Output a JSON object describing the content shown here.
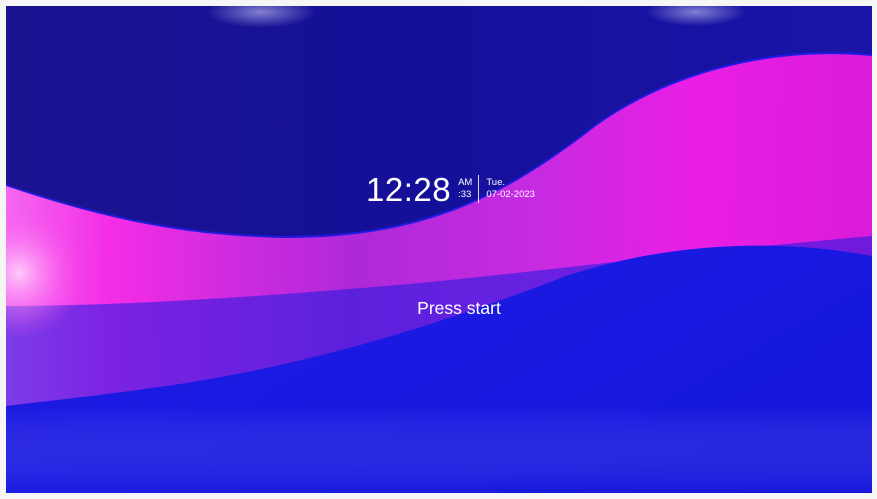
{
  "screen": {
    "time": "12:28",
    "ampm": "AM",
    "seconds": ":33",
    "weekday": "Tue.",
    "date": "07-02-2023",
    "prompt": "Press start"
  },
  "colors": {
    "background_blue": "#1a1ae0",
    "top_navy": "#140f96",
    "wave_magenta": "#e81ee0",
    "text": "#ffffff"
  }
}
